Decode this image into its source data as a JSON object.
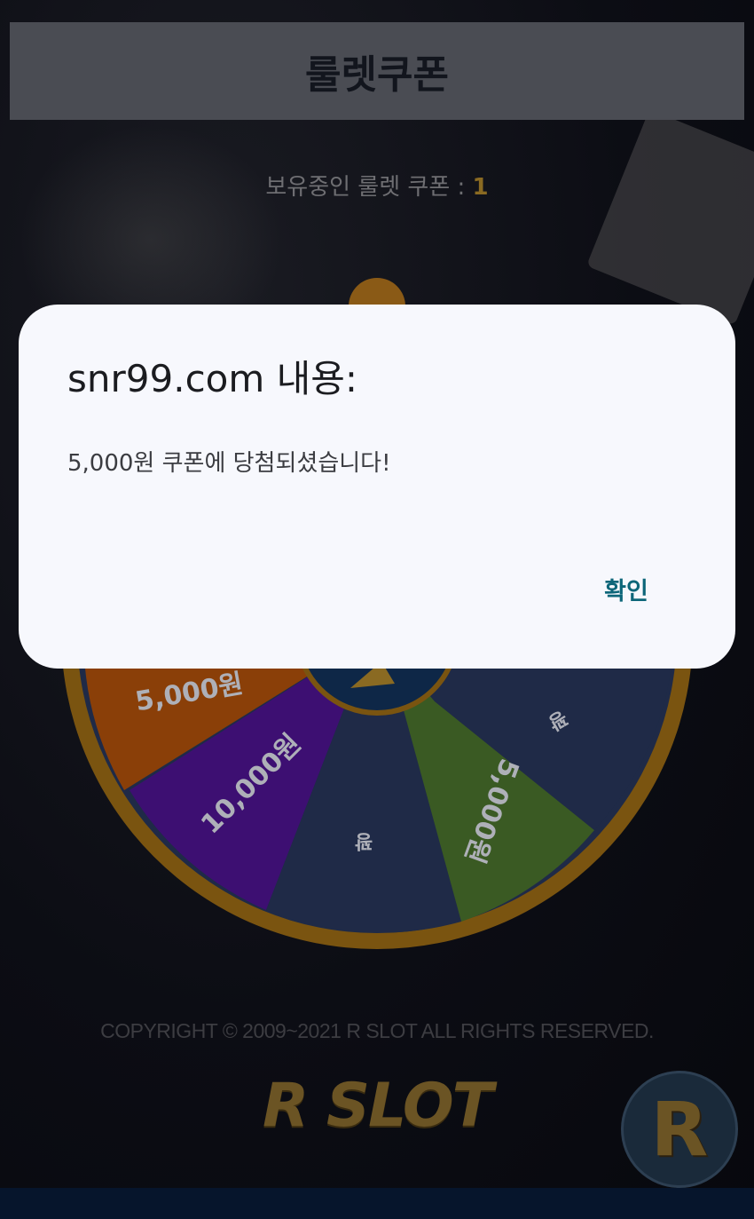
{
  "header": {
    "title": "룰렛쿠폰"
  },
  "coupon_status": {
    "label": "보유중인 룰렛 쿠폰 :",
    "count": "1"
  },
  "wheel": {
    "segments": [
      {
        "label": "5,000원",
        "color": "#8a3f08"
      },
      {
        "label": "10,000원",
        "color": "#3d0f72"
      },
      {
        "label": "꽝",
        "color": "#1f2a47"
      },
      {
        "label": "5,000원",
        "color": "#3a5a23"
      },
      {
        "label": "꽝",
        "color": "#1f2a47"
      }
    ],
    "rim_color": "#8a6112",
    "hub_color": "#0e2747"
  },
  "footer": {
    "copyright": "COPYRIGHT © 2009~2021 R SLOT ALL RIGHTS RESERVED.",
    "logo": "R SLOT",
    "float_button": "R"
  },
  "dialog": {
    "title": "snr99.com 내용:",
    "message": "5,000원 쿠폰에 당첨되셨습니다!",
    "ok_label": "확인"
  }
}
